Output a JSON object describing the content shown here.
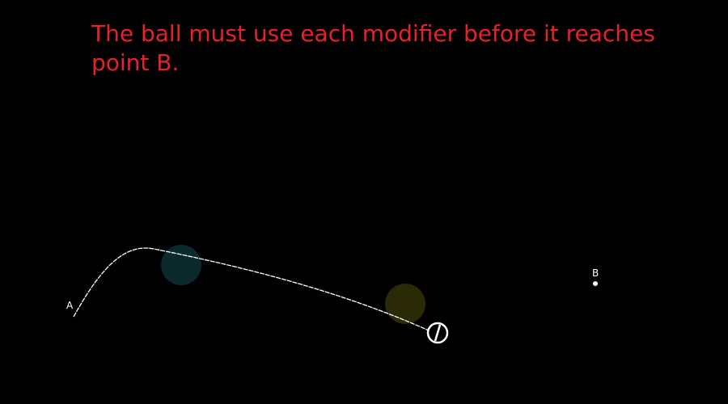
{
  "instruction": "The ball must use each modifier before it reaches point B.",
  "start_point": {
    "label": "A"
  },
  "end_point": {
    "label": "B"
  },
  "modifiers": [
    {
      "name": "modifier-teal",
      "color": "#0a2a2c"
    },
    {
      "name": "modifier-olive",
      "color": "#2a2a06"
    }
  ],
  "colors": {
    "background": "#000000",
    "instruction_text": "#e8202a",
    "path": "#ffffff",
    "ball_outline": "#ffffff",
    "labels": "#ffffff"
  }
}
